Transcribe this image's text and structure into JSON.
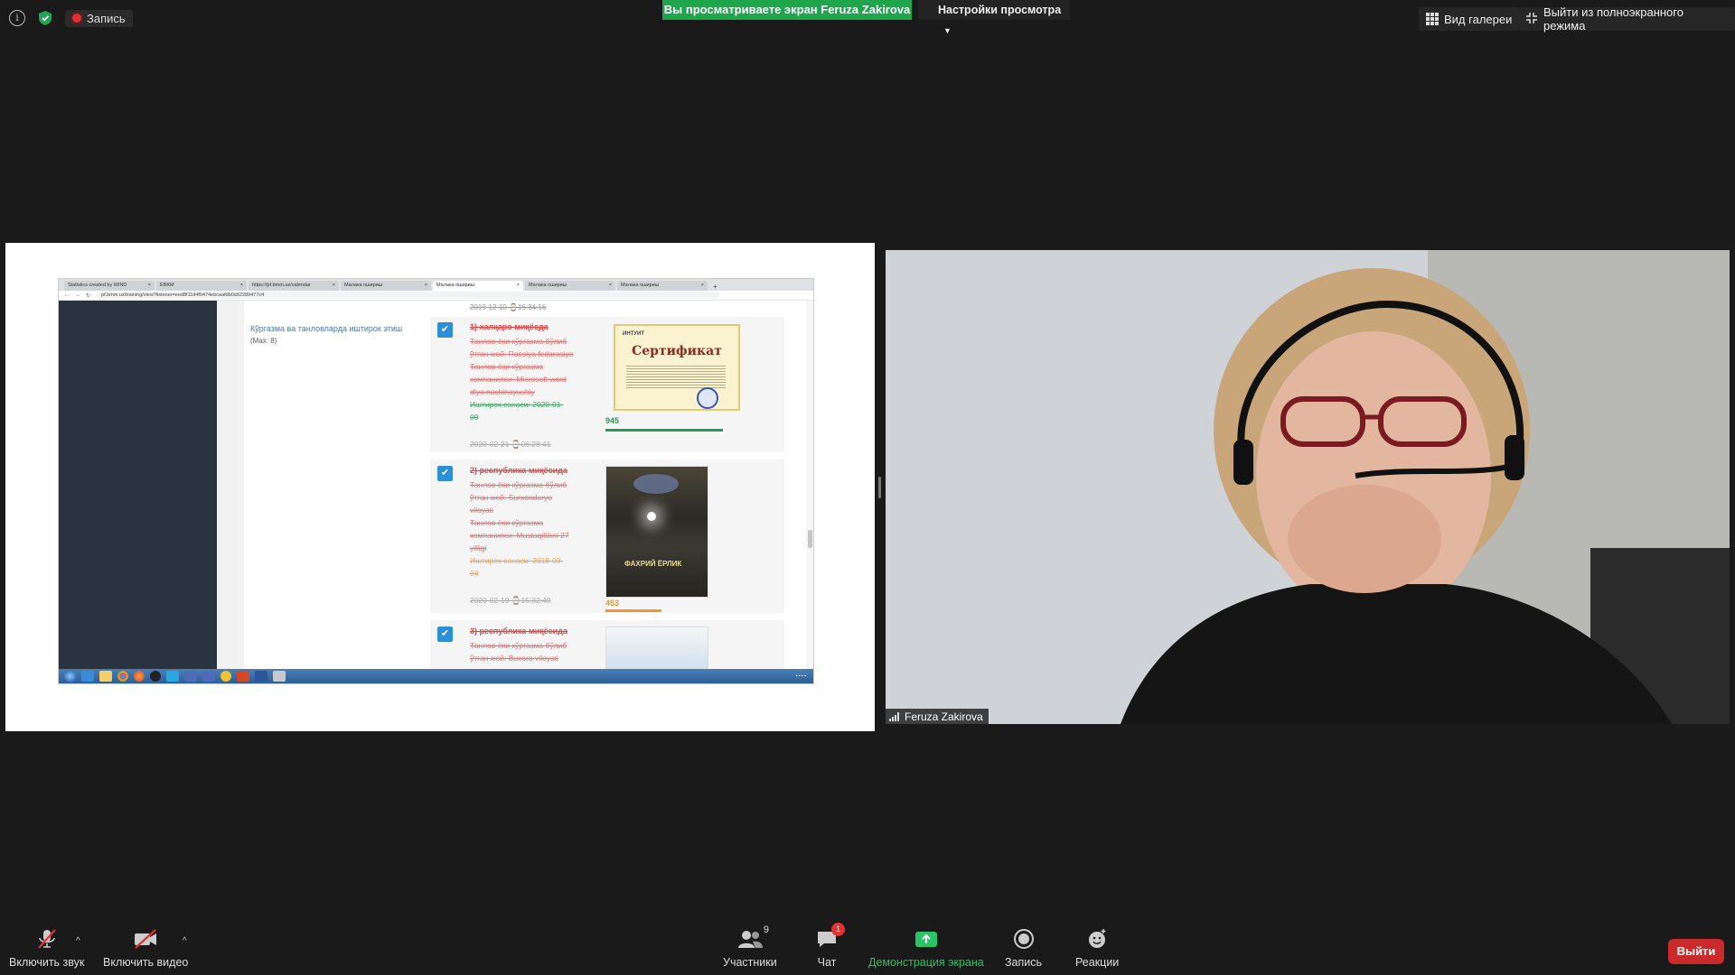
{
  "top_bar": {
    "recording_label": "Запись",
    "viewing_banner": "Вы просматриваете экран Feruza Zakirova",
    "view_settings": "Настройки просмотра",
    "gallery_view": "Вид галереи",
    "exit_fullscreen": "Выйти из полноэкранного режима"
  },
  "shared_screen": {
    "tabs": [
      {
        "label": "Statistics created by WIND"
      },
      {
        "label": "EBKM"
      },
      {
        "label": "https://pf.bmm.uz/calendar"
      },
      {
        "label": "Малака ошириш"
      },
      {
        "label": "Малака ошириш"
      },
      {
        "label": "Малака ошириш"
      },
      {
        "label": "Малака ошириш"
      }
    ],
    "url": "pf.bmm.uz/training/view?listener=eed8f11d4f0474ebcaafdb0a52289477c4",
    "top_date": "2019-12-10 ⌚16:34:16",
    "section_title": "Кўргазма ва танловларда иштирок этиш",
    "section_sub": "(Max: 8)",
    "entries": [
      {
        "title": "1) халқаро миқёсда",
        "lines": [
          "Танлов ёки кўргазма бўлиб",
          "ўтган жой: Rossiya fedarasiya",
          "Танлов ёки кўргазма",
          "компанияси: Microsoft word",
          "dlya nachinayushiy"
        ],
        "date_label": "Иштирок санаси: 2020-01-",
        "date_label2": "09",
        "stamp": "2020-02-21 ⌚06:28:41",
        "score": "945",
        "badge": "0",
        "cert_title": "Сертификат",
        "cert_org": "ИНТУИТ"
      },
      {
        "title": "2) республика миқёсида",
        "lines": [
          "Танлов ёки кўргазма бўлиб",
          "ўтган жой: Surxondaryo",
          "viloyati",
          "Танлов ёки кўргазма",
          "компанияси: Mustaqillikni 27",
          "yilligi"
        ],
        "date_label": "Иштирок санаси: 2018-09-",
        "date_label2": "04",
        "stamp": "2020-02-19 ⌚15:32:49",
        "score": "453",
        "badge": "0",
        "photo_caption": "ФАХРИЙ ЁРЛИК"
      },
      {
        "title": "3) республика миқёсида",
        "lines": [
          "Танлов ёки кўргазма бўлиб",
          "ўтган жой: Buxoro viloyati"
        ],
        "badge": "0"
      }
    ]
  },
  "participant": {
    "name": "Feruza Zakirova"
  },
  "toolbar": {
    "audio": "Включить звук",
    "video": "Включить видео",
    "participants": "Участники",
    "participants_count": "9",
    "chat": "Чат",
    "chat_badge": "1",
    "share": "Демонстрация экрана",
    "record": "Запись",
    "reactions": "Реакции",
    "leave": "Выйти"
  }
}
